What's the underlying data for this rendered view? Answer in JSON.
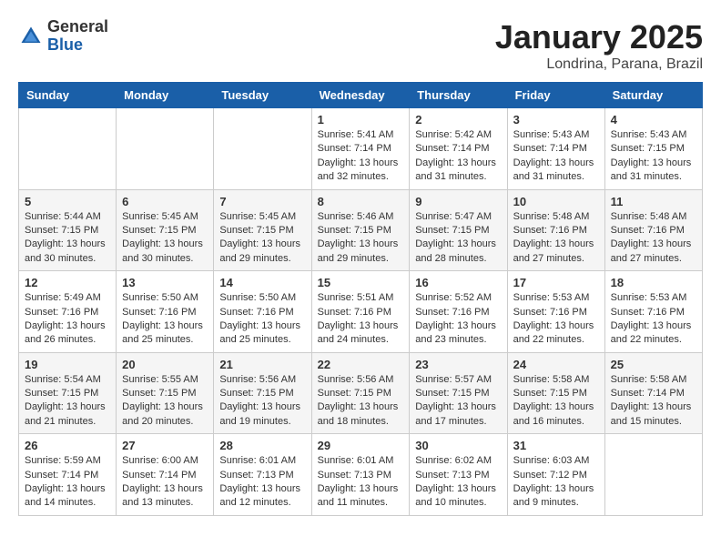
{
  "header": {
    "logo_general": "General",
    "logo_blue": "Blue",
    "month": "January 2025",
    "location": "Londrina, Parana, Brazil"
  },
  "weekdays": [
    "Sunday",
    "Monday",
    "Tuesday",
    "Wednesday",
    "Thursday",
    "Friday",
    "Saturday"
  ],
  "weeks": [
    [
      {
        "day": "",
        "content": ""
      },
      {
        "day": "",
        "content": ""
      },
      {
        "day": "",
        "content": ""
      },
      {
        "day": "1",
        "content": "Sunrise: 5:41 AM\nSunset: 7:14 PM\nDaylight: 13 hours\nand 32 minutes."
      },
      {
        "day": "2",
        "content": "Sunrise: 5:42 AM\nSunset: 7:14 PM\nDaylight: 13 hours\nand 31 minutes."
      },
      {
        "day": "3",
        "content": "Sunrise: 5:43 AM\nSunset: 7:14 PM\nDaylight: 13 hours\nand 31 minutes."
      },
      {
        "day": "4",
        "content": "Sunrise: 5:43 AM\nSunset: 7:15 PM\nDaylight: 13 hours\nand 31 minutes."
      }
    ],
    [
      {
        "day": "5",
        "content": "Sunrise: 5:44 AM\nSunset: 7:15 PM\nDaylight: 13 hours\nand 30 minutes."
      },
      {
        "day": "6",
        "content": "Sunrise: 5:45 AM\nSunset: 7:15 PM\nDaylight: 13 hours\nand 30 minutes."
      },
      {
        "day": "7",
        "content": "Sunrise: 5:45 AM\nSunset: 7:15 PM\nDaylight: 13 hours\nand 29 minutes."
      },
      {
        "day": "8",
        "content": "Sunrise: 5:46 AM\nSunset: 7:15 PM\nDaylight: 13 hours\nand 29 minutes."
      },
      {
        "day": "9",
        "content": "Sunrise: 5:47 AM\nSunset: 7:15 PM\nDaylight: 13 hours\nand 28 minutes."
      },
      {
        "day": "10",
        "content": "Sunrise: 5:48 AM\nSunset: 7:16 PM\nDaylight: 13 hours\nand 27 minutes."
      },
      {
        "day": "11",
        "content": "Sunrise: 5:48 AM\nSunset: 7:16 PM\nDaylight: 13 hours\nand 27 minutes."
      }
    ],
    [
      {
        "day": "12",
        "content": "Sunrise: 5:49 AM\nSunset: 7:16 PM\nDaylight: 13 hours\nand 26 minutes."
      },
      {
        "day": "13",
        "content": "Sunrise: 5:50 AM\nSunset: 7:16 PM\nDaylight: 13 hours\nand 25 minutes."
      },
      {
        "day": "14",
        "content": "Sunrise: 5:50 AM\nSunset: 7:16 PM\nDaylight: 13 hours\nand 25 minutes."
      },
      {
        "day": "15",
        "content": "Sunrise: 5:51 AM\nSunset: 7:16 PM\nDaylight: 13 hours\nand 24 minutes."
      },
      {
        "day": "16",
        "content": "Sunrise: 5:52 AM\nSunset: 7:16 PM\nDaylight: 13 hours\nand 23 minutes."
      },
      {
        "day": "17",
        "content": "Sunrise: 5:53 AM\nSunset: 7:16 PM\nDaylight: 13 hours\nand 22 minutes."
      },
      {
        "day": "18",
        "content": "Sunrise: 5:53 AM\nSunset: 7:16 PM\nDaylight: 13 hours\nand 22 minutes."
      }
    ],
    [
      {
        "day": "19",
        "content": "Sunrise: 5:54 AM\nSunset: 7:15 PM\nDaylight: 13 hours\nand 21 minutes."
      },
      {
        "day": "20",
        "content": "Sunrise: 5:55 AM\nSunset: 7:15 PM\nDaylight: 13 hours\nand 20 minutes."
      },
      {
        "day": "21",
        "content": "Sunrise: 5:56 AM\nSunset: 7:15 PM\nDaylight: 13 hours\nand 19 minutes."
      },
      {
        "day": "22",
        "content": "Sunrise: 5:56 AM\nSunset: 7:15 PM\nDaylight: 13 hours\nand 18 minutes."
      },
      {
        "day": "23",
        "content": "Sunrise: 5:57 AM\nSunset: 7:15 PM\nDaylight: 13 hours\nand 17 minutes."
      },
      {
        "day": "24",
        "content": "Sunrise: 5:58 AM\nSunset: 7:15 PM\nDaylight: 13 hours\nand 16 minutes."
      },
      {
        "day": "25",
        "content": "Sunrise: 5:58 AM\nSunset: 7:14 PM\nDaylight: 13 hours\nand 15 minutes."
      }
    ],
    [
      {
        "day": "26",
        "content": "Sunrise: 5:59 AM\nSunset: 7:14 PM\nDaylight: 13 hours\nand 14 minutes."
      },
      {
        "day": "27",
        "content": "Sunrise: 6:00 AM\nSunset: 7:14 PM\nDaylight: 13 hours\nand 13 minutes."
      },
      {
        "day": "28",
        "content": "Sunrise: 6:01 AM\nSunset: 7:13 PM\nDaylight: 13 hours\nand 12 minutes."
      },
      {
        "day": "29",
        "content": "Sunrise: 6:01 AM\nSunset: 7:13 PM\nDaylight: 13 hours\nand 11 minutes."
      },
      {
        "day": "30",
        "content": "Sunrise: 6:02 AM\nSunset: 7:13 PM\nDaylight: 13 hours\nand 10 minutes."
      },
      {
        "day": "31",
        "content": "Sunrise: 6:03 AM\nSunset: 7:12 PM\nDaylight: 13 hours\nand 9 minutes."
      },
      {
        "day": "",
        "content": ""
      }
    ]
  ]
}
